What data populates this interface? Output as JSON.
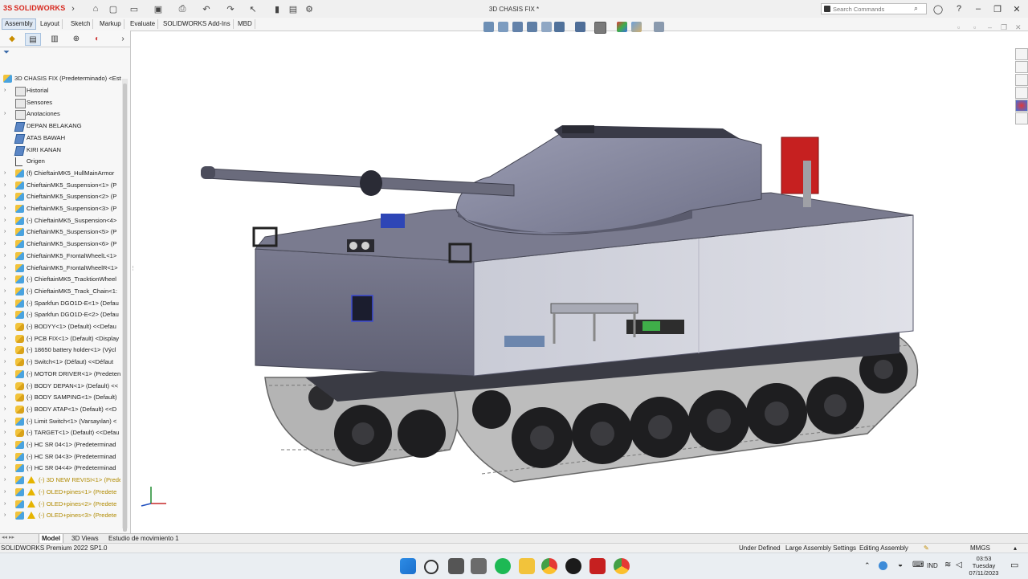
{
  "app": {
    "logo_text": "SOLIDWORKS",
    "document_title": "3D CHASIS FIX *",
    "search_placeholder": "Search Commands"
  },
  "command_tabs": [
    "Assembly",
    "Layout",
    "Sketch",
    "Markup",
    "Evaluate",
    "SOLIDWORKS Add-Ins",
    "MBD"
  ],
  "tree": {
    "root": "3D CHASIS FIX (Predeterminado) <Est",
    "items": [
      {
        "label": "Historial",
        "icon": "folder"
      },
      {
        "label": "Sensores",
        "icon": "folder"
      },
      {
        "label": "Anotaciones",
        "icon": "folder"
      },
      {
        "label": "DEPAN BELAKANG",
        "icon": "plane"
      },
      {
        "label": "ATAS BAWAH",
        "icon": "plane"
      },
      {
        "label": "KIRI KANAN",
        "icon": "plane"
      },
      {
        "label": "Origen",
        "icon": "origin"
      },
      {
        "label": "(f) ChieftainMK5_HullMainArmor",
        "icon": "asm"
      },
      {
        "label": "ChieftainMK5_Suspension<1> (P",
        "icon": "asm"
      },
      {
        "label": "ChieftainMK5_Suspension<2> (P",
        "icon": "asm"
      },
      {
        "label": "ChieftainMK5_Suspension<3> (P",
        "icon": "asm"
      },
      {
        "label": "(-) ChieftainMK5_Suspension<4>",
        "icon": "asm"
      },
      {
        "label": "ChieftainMK5_Suspension<5> (P",
        "icon": "asm"
      },
      {
        "label": "ChieftainMK5_Suspension<6> (P",
        "icon": "asm"
      },
      {
        "label": "ChieftainMK5_FrontalWheelL<1>",
        "icon": "asm"
      },
      {
        "label": "ChieftainMK5_FrontalWheelR<1>",
        "icon": "asm"
      },
      {
        "label": "(-) ChieftainMK5_TracktionWheel",
        "icon": "asm"
      },
      {
        "label": "(-) ChieftainMK5_Track_Chain<1:",
        "icon": "asm"
      },
      {
        "label": "(-) Sparkfun DGO1D-E<1> (Defau",
        "icon": "asm"
      },
      {
        "label": "(-) Sparkfun DGO1D-E<2> (Defau",
        "icon": "asm"
      },
      {
        "label": "(-) BODYY<1> (Default) <<Defau",
        "icon": "part"
      },
      {
        "label": "(-) PCB FIX<1> (Default) <Display",
        "icon": "part"
      },
      {
        "label": "(-) 18650 battery holder<1> (Výcl",
        "icon": "part"
      },
      {
        "label": "(-) Switch<1> (Défaut) <<Défaut",
        "icon": "part"
      },
      {
        "label": "(-) MOTOR DRIVER<1> (Predeten",
        "icon": "asm"
      },
      {
        "label": "(-) BODY DEPAN<1> (Default) <<",
        "icon": "part"
      },
      {
        "label": "(-) BODY SAMPING<1> (Default)",
        "icon": "part"
      },
      {
        "label": "(-) BODY ATAP<1> (Default) <<D",
        "icon": "part"
      },
      {
        "label": "(-) Limit Switch<1> (Varsayılan) <",
        "icon": "asm"
      },
      {
        "label": "(-) TARGET<1> (Default) <<Defau",
        "icon": "part"
      },
      {
        "label": "(-) HC SR 04<1> (Predeterminad",
        "icon": "asm"
      },
      {
        "label": "(-) HC SR 04<3> (Predeterminad",
        "icon": "asm"
      },
      {
        "label": "(-) HC SR 04<4> (Predeterminad",
        "icon": "asm"
      },
      {
        "label": "(-) 3D NEW REVISI<1> (Prede",
        "icon": "asm",
        "warning": true
      },
      {
        "label": "(-) OLED+pines<1> (Predete",
        "icon": "asm",
        "warning": true
      },
      {
        "label": "(-) OLED+pines<2> (Predete",
        "icon": "asm",
        "warning": true
      },
      {
        "label": "(-) OLED+pines<3> (Predete",
        "icon": "asm",
        "warning": true
      }
    ]
  },
  "bottom_tabs": [
    "Model",
    "3D Views",
    "Estudio de movimiento 1"
  ],
  "status": {
    "left": "SOLIDWORKS Premium 2022 SP1.0",
    "under_defined": "Under Defined",
    "large_settings": "Large Assembly Settings",
    "editing": "Editing Assembly",
    "units": "MMGS"
  },
  "taskbar": {
    "language": "IND",
    "time": "03:53",
    "day": "Tuesday",
    "date": "07/11/2023"
  },
  "colors": {
    "tank_body": "#6c6d80",
    "turret": "#8a8ca0",
    "track": "#9a9a9a",
    "wheels": "#1e1e20",
    "target": "#c62020"
  }
}
